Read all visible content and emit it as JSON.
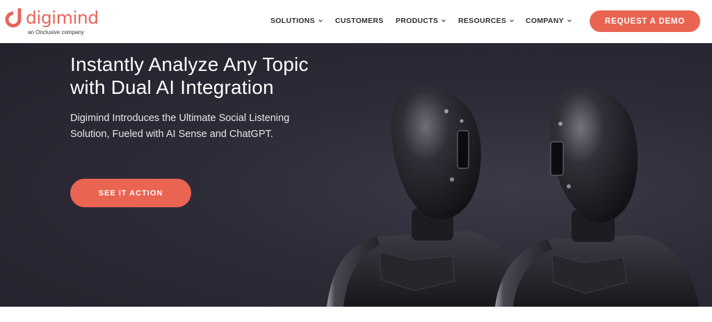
{
  "header": {
    "logo": {
      "wordmark": "digimind",
      "tagline": "an Onclusive company"
    },
    "nav": [
      {
        "label": "SOLUTIONS",
        "dropdown": true
      },
      {
        "label": "CUSTOMERS",
        "dropdown": false
      },
      {
        "label": "PRODUCTS",
        "dropdown": true
      },
      {
        "label": "RESOURCES",
        "dropdown": true
      },
      {
        "label": "COMPANY",
        "dropdown": true
      }
    ],
    "cta_label": "REQUEST A DEMO"
  },
  "hero": {
    "title_line1": "Instantly Analyze Any Topic",
    "title_line2": "with Dual AI Integration",
    "subtitle": "Digimind Introduces the Ultimate Social Listening Solution, Fueled with AI Sense and ChatGPT.",
    "button_label": "SEE IT ACTION"
  },
  "colors": {
    "accent": "#ea6452",
    "hero_bg": "#2c2b37",
    "nav_text": "#2b2d33"
  },
  "icons": {
    "nav_dropdown": "chevron-down-icon",
    "logo": "digimind-logo-mark"
  }
}
